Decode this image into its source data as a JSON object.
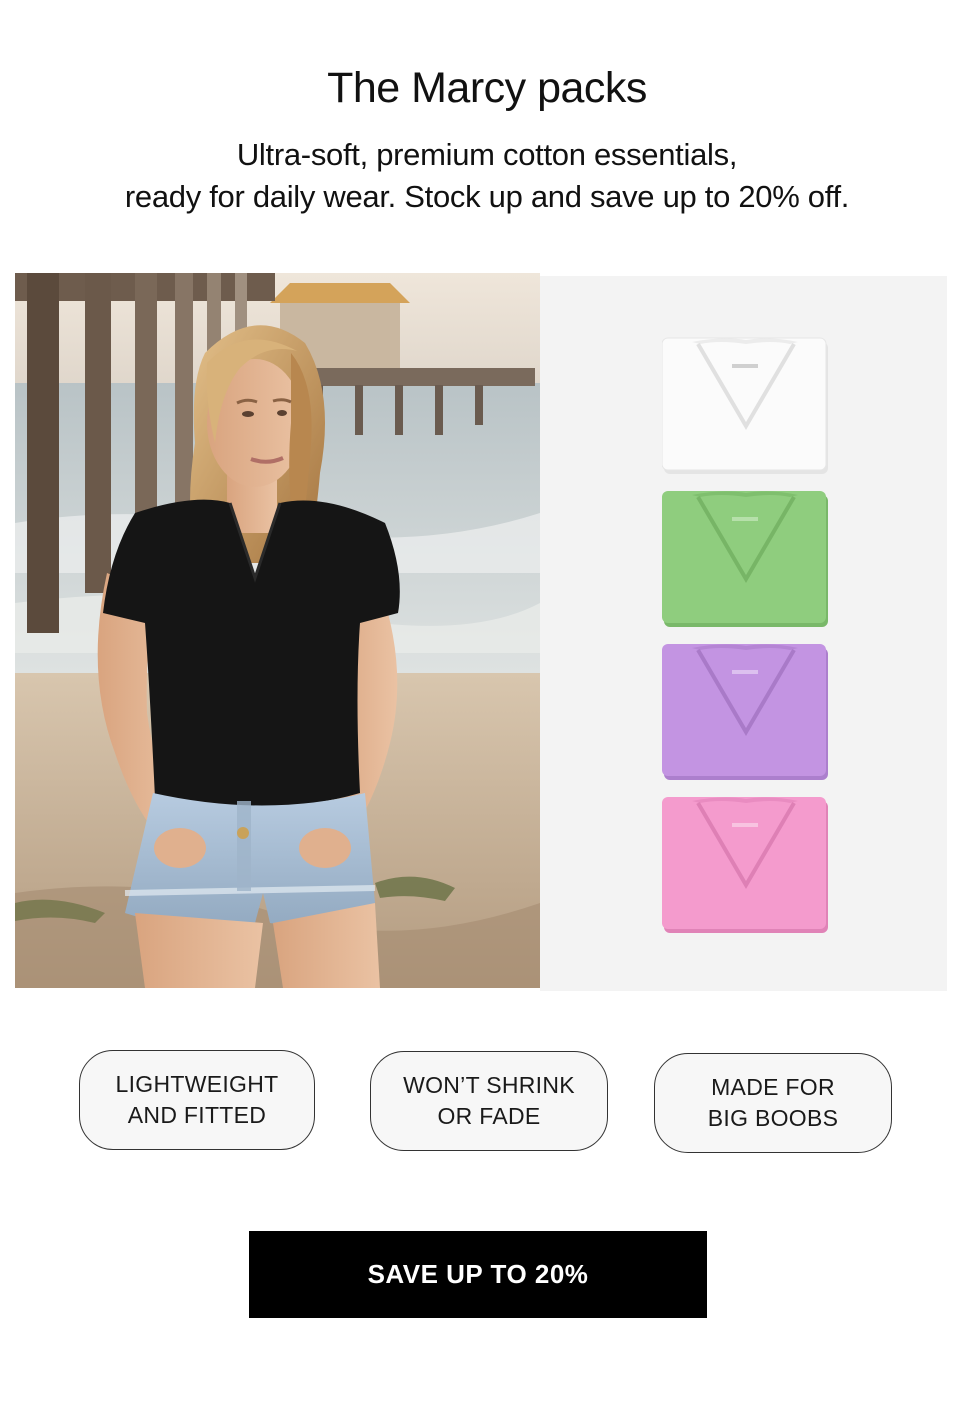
{
  "header": {
    "title": "The Marcy packs",
    "subtitle_line1": "Ultra-soft, premium cotton essentials,",
    "subtitle_line2": "ready for daily wear. Stock up and save up to 20% off."
  },
  "lifestyle_image": {
    "subject": "woman in black v-neck tee on beach by pier",
    "colors": {
      "sky": "#e7ddd0",
      "sea": "#c9d0d3",
      "sand": "#c8b49c",
      "tee": "#151515",
      "denim": "#a9bfd2",
      "hair": "#c89c64",
      "skin": "#e2b494",
      "pier": "#5b4a3c"
    }
  },
  "product_stack": {
    "tees": [
      {
        "name": "white-tee",
        "color": "#fbfbfb",
        "shadow": "#e4e4e4"
      },
      {
        "name": "green-tee",
        "color": "#8fcd7e",
        "shadow": "#79b869"
      },
      {
        "name": "lavender-tee",
        "color": "#c394e2",
        "shadow": "#ac7fcd"
      },
      {
        "name": "pink-tee",
        "color": "#f49bcd",
        "shadow": "#e083b7"
      }
    ],
    "panel_color": "#f3f3f3"
  },
  "features": [
    {
      "line1": "LIGHTWEIGHT",
      "line2": "AND FITTED"
    },
    {
      "line1": "WON’T SHRINK",
      "line2": "OR FADE"
    },
    {
      "line1": "MADE FOR",
      "line2": "BIG BOOBS"
    }
  ],
  "cta": {
    "label": "SAVE UP TO 20%",
    "background": "#000000",
    "text_color": "#ffffff"
  }
}
